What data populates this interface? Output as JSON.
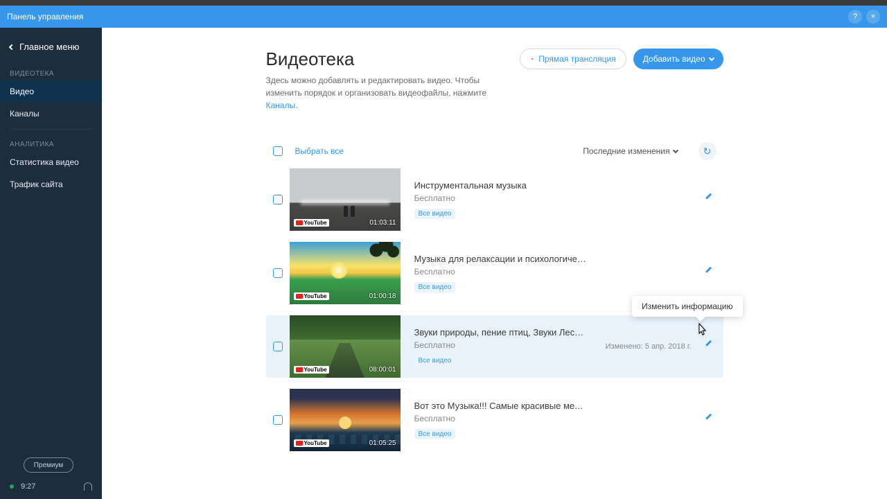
{
  "topbar": {
    "title": "Панель управления",
    "help": "?",
    "close": "×"
  },
  "sidebar": {
    "back": "Главное меню",
    "group1": "ВИДЕОТЕКА",
    "items1": [
      "Видео",
      "Каналы"
    ],
    "group2": "АНАЛИТИКА",
    "items2": [
      "Статистика видео",
      "Трафик сайта"
    ],
    "premium": "Премиум",
    "time": "9:27"
  },
  "page": {
    "title": "Видеотека",
    "desc_a": "Здесь можно добавлять и редактировать видео. Чтобы изменить порядок и организовать видеофайлы, нажмите ",
    "desc_link": "Каналы",
    "live_btn": "Прямая трансляция",
    "add_btn": "Добавить видео"
  },
  "list": {
    "select_all": "Выбрать все",
    "sort": "Последние изменения",
    "refresh": "↻",
    "tooltip": "Изменить информацию",
    "items": [
      {
        "title": "Инструментальная музыка",
        "price": "Бесплатно",
        "tag": "Все видео",
        "dur": "01:03:11",
        "meta": ""
      },
      {
        "title": "Музыка для релаксации и психологической ра…",
        "price": "Бесплатно",
        "tag": "Все видео",
        "dur": "01:00:18",
        "meta": ""
      },
      {
        "title": "Звуки природы, пение птиц, Звуки Леса, для р…",
        "price": "Бесплатно",
        "tag": "Все видео",
        "dur": "08:00:01",
        "meta": "Изменено: 5 апр. 2018 г."
      },
      {
        "title": "Вот это Музыка!!! Самые красивые мелодии н…",
        "price": "Бесплатно",
        "tag": "Все видео",
        "dur": "01:05:25",
        "meta": ""
      }
    ]
  }
}
